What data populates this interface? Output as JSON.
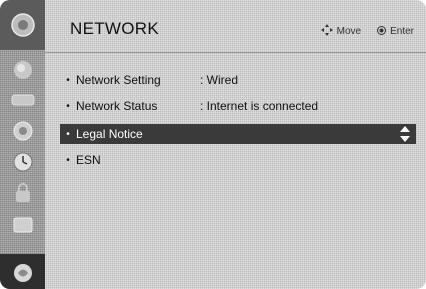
{
  "title": "NETWORK",
  "hints": {
    "move": "Move",
    "enter": "Enter"
  },
  "sidebar": {
    "icons": [
      "tv-icon",
      "picture-icon",
      "audio-icon",
      "time-icon",
      "lock-icon",
      "option-icon",
      "network-icon"
    ],
    "active": "network-icon"
  },
  "menu": [
    {
      "label": "Network Setting",
      "value": ": Wired"
    },
    {
      "label": "Network Status",
      "value": ": Internet is connected"
    },
    {
      "label": "Legal Notice",
      "value": ""
    },
    {
      "label": "ESN",
      "value": ""
    }
  ],
  "bullet": "•",
  "colors": {
    "selected_bg": "#3a3a3a",
    "sidebar_active": "#2e2e2e"
  }
}
